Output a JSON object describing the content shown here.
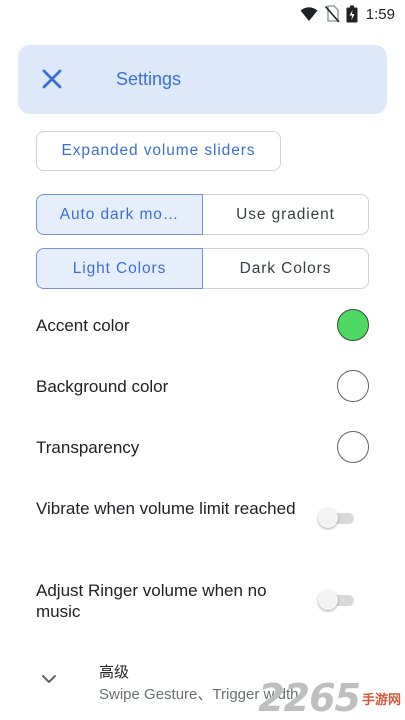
{
  "status_bar": {
    "time": "1:59"
  },
  "header": {
    "title": "Settings",
    "close_icon": "close-icon"
  },
  "expanded_volume_sliders": "Expanded volume sliders",
  "theme_toggle": {
    "auto_dark": "Auto dark mo…",
    "use_gradient": "Use gradient",
    "active": "auto_dark"
  },
  "color_mode": {
    "light": "Light Colors",
    "dark": "Dark Colors",
    "active": "light"
  },
  "colors": [
    {
      "label": "Accent color",
      "value": "#4cd964"
    },
    {
      "label": "Background color",
      "value": "#ffffff"
    },
    {
      "label": "Transparency",
      "value": "#ffffff"
    }
  ],
  "toggles": [
    {
      "label": "Vibrate when volume limit reached",
      "on": false
    },
    {
      "label": "Adjust Ringer volume when no music",
      "on": false
    }
  ],
  "advanced": {
    "title": "高级",
    "subtitle": "Swipe Gesture、Trigger width"
  },
  "watermark": {
    "number": "2265",
    "suffix": ".com",
    "chinese": "手游网"
  },
  "accent": "#3a6fd8"
}
